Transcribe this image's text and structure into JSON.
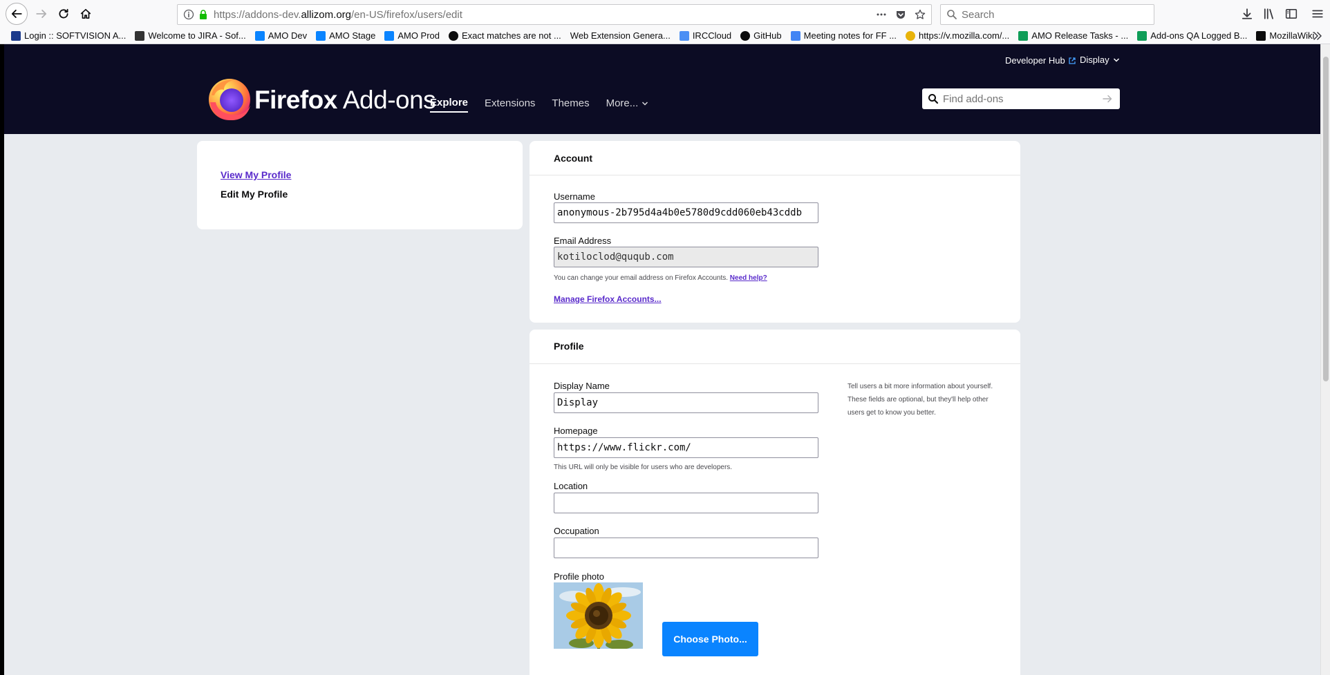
{
  "browser": {
    "url_prefix": "https://addons-dev.",
    "url_host": "allizom.org",
    "url_path": "/en-US/firefox/users/edit",
    "search_placeholder": "Search",
    "bookmarks": [
      {
        "label": "Login :: SOFTVISION A...",
        "icon": "softvision-icon",
        "color": "#1b3a8c"
      },
      {
        "label": "Welcome to JIRA - Sof...",
        "icon": "jira-icon",
        "color": "#333333"
      },
      {
        "label": "AMO Dev",
        "icon": "amo-icon",
        "color": "#0a84ff"
      },
      {
        "label": "AMO Stage",
        "icon": "amo-icon",
        "color": "#0a84ff"
      },
      {
        "label": "AMO Prod",
        "icon": "amo-icon",
        "color": "#0a84ff"
      },
      {
        "label": "Exact matches are not ...",
        "icon": "github-icon",
        "color": "#0c0c0d"
      },
      {
        "label": "Web Extension Genera...",
        "icon": "blank-icon",
        "color": "#ffffff"
      },
      {
        "label": "IRCCloud",
        "icon": "irccloud-icon",
        "color": "#4b8ff4"
      },
      {
        "label": "GitHub",
        "icon": "github-icon",
        "color": "#0c0c0d"
      },
      {
        "label": "Meeting notes for FF ...",
        "icon": "docs-icon",
        "color": "#4285f4"
      },
      {
        "label": "https://v.mozilla.com/...",
        "icon": "mozilla-icon",
        "color": "#e8b30a"
      },
      {
        "label": "AMO Release Tasks - ...",
        "icon": "sheets-icon",
        "color": "#0f9d58"
      },
      {
        "label": "Add-ons QA Logged B...",
        "icon": "sheets-icon",
        "color": "#0f9d58"
      },
      {
        "label": "MozillaWiki",
        "icon": "mozillawiki-icon",
        "color": "#0c0c0d"
      }
    ]
  },
  "header": {
    "dev_hub": "Developer Hub",
    "display_menu": "Display",
    "brand_firefox": "Firefox",
    "brand_addons": "Add-ons",
    "nav": [
      {
        "label": "Explore",
        "active": true
      },
      {
        "label": "Extensions",
        "active": false
      },
      {
        "label": "Themes",
        "active": false
      }
    ],
    "more_label": "More...",
    "search_placeholder": "Find add-ons"
  },
  "sidebar": {
    "view_profile": "View My Profile",
    "edit_profile": "Edit My Profile"
  },
  "account": {
    "title": "Account",
    "username_label": "Username",
    "username_value": "anonymous-2b795d4a4b0e5780d9cdd060eb43cddb",
    "email_label": "Email Address",
    "email_value": "kotiloclod@ququb.com",
    "email_hint": "You can change your email address on Firefox Accounts.",
    "email_help": "Need help?",
    "manage_link": "Manage Firefox Accounts..."
  },
  "profile": {
    "title": "Profile",
    "note": "Tell users a bit more information about yourself. These fields are optional, but they'll help other users get to know you better.",
    "display_name_label": "Display Name",
    "display_name_value": "Display",
    "homepage_label": "Homepage",
    "homepage_value": "https://www.flickr.com/",
    "homepage_hint": "This URL will only be visible for users who are developers.",
    "location_label": "Location",
    "location_value": "",
    "occupation_label": "Occupation",
    "occupation_value": "",
    "photo_label": "Profile photo",
    "choose_photo": "Choose Photo..."
  },
  "colors": {
    "header_bg": "#0c0c24",
    "page_bg": "#e8ebef",
    "accent": "#0a84ff",
    "link": "#592acb"
  }
}
